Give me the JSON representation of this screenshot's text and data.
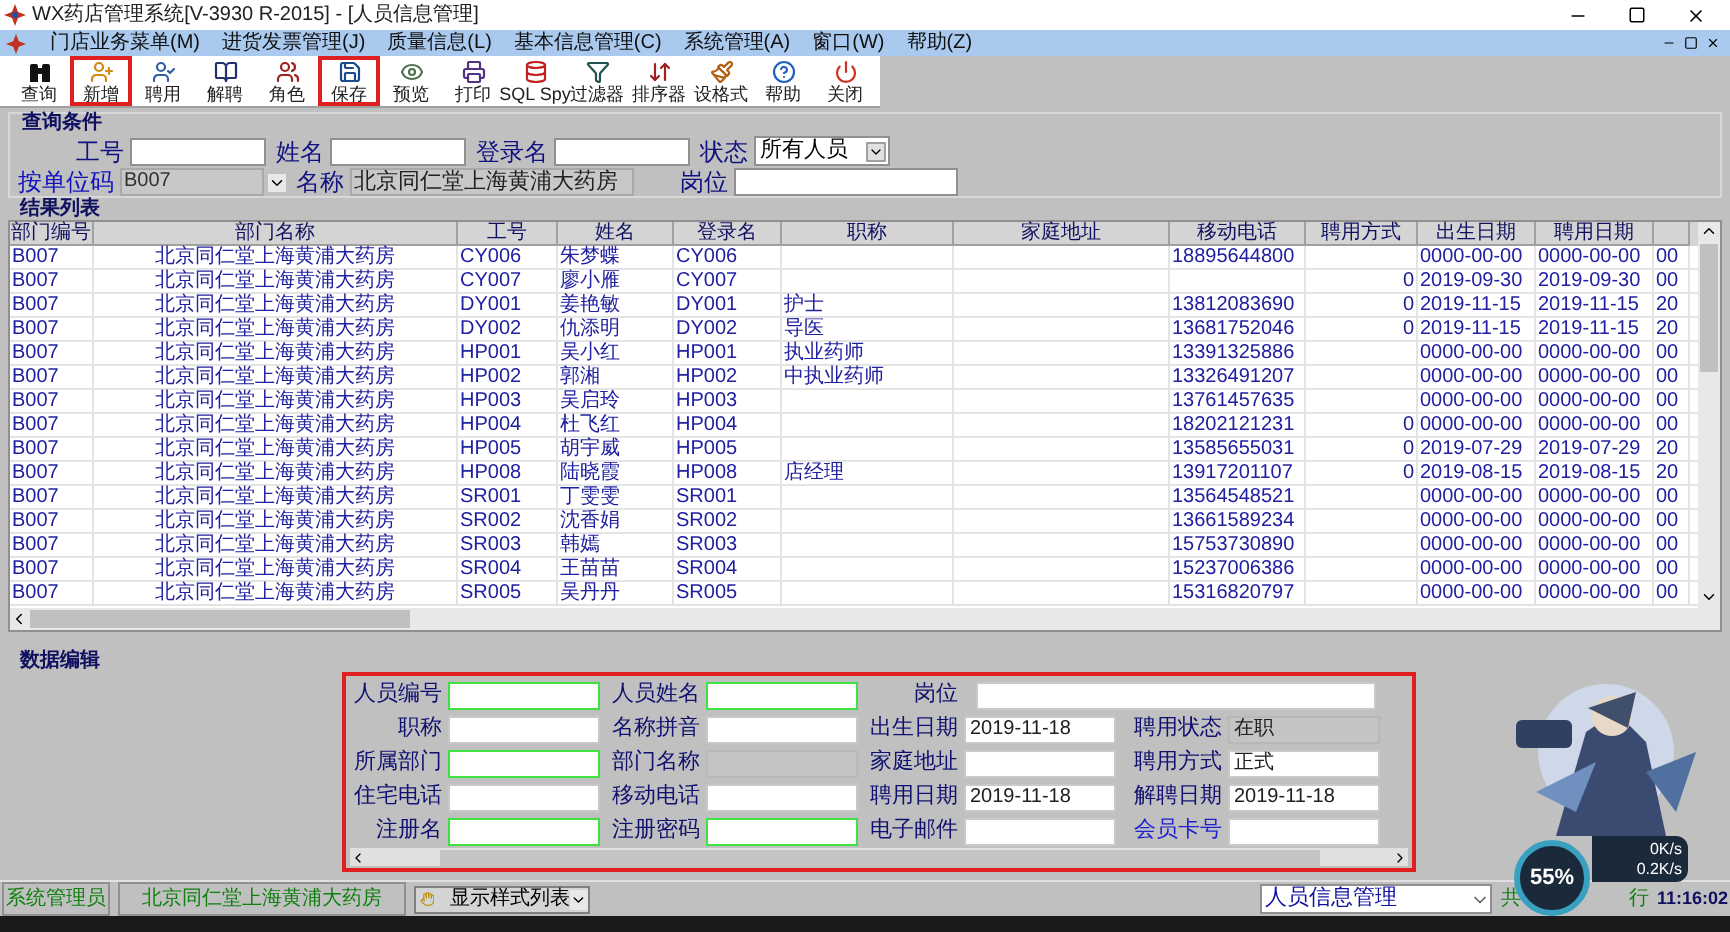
{
  "window": {
    "title": "WX药店管理系统[V-3930 R-2015] - [人员信息管理]"
  },
  "menu": [
    {
      "label": "门店业务菜单(M)"
    },
    {
      "label": "进货发票管理(J)"
    },
    {
      "label": "质量信息(L)"
    },
    {
      "label": "基本信息管理(C)"
    },
    {
      "label": "系统管理(A)"
    },
    {
      "label": "窗口(W)"
    },
    {
      "label": "帮助(Z)"
    }
  ],
  "toolbar": [
    {
      "label": "查询",
      "highlighted": false
    },
    {
      "label": "新增",
      "highlighted": true
    },
    {
      "label": "聘用",
      "highlighted": false
    },
    {
      "label": "解聘",
      "highlighted": false
    },
    {
      "label": "角色",
      "highlighted": false
    },
    {
      "label": "保存",
      "highlighted": true
    },
    {
      "label": "预览",
      "highlighted": false
    },
    {
      "label": "打印",
      "highlighted": false
    },
    {
      "label": "SQL Spy",
      "highlighted": false
    },
    {
      "label": "过滤器",
      "highlighted": false
    },
    {
      "label": "排序器",
      "highlighted": false
    },
    {
      "label": "设格式",
      "highlighted": false
    },
    {
      "label": "帮助",
      "highlighted": false
    },
    {
      "label": "关闭",
      "highlighted": false
    }
  ],
  "query": {
    "title": "查询条件",
    "fields": [
      {
        "label": "工号",
        "kind": "text",
        "link": false
      },
      {
        "label": "姓名",
        "kind": "text",
        "link": false
      },
      {
        "label": "登录名",
        "kind": "text",
        "link": false
      },
      {
        "label": "状态",
        "kind": "select",
        "value": "所有人员",
        "link": false
      },
      {
        "label": "按单位码",
        "kind": "code",
        "value": "B007",
        "link": true
      },
      {
        "label": "名称",
        "kind": "readonly",
        "value": "北京同仁堂上海黄浦大药房",
        "link": false
      },
      {
        "label": "岗位",
        "kind": "wide",
        "link": false
      }
    ]
  },
  "results": {
    "title": "结果列表",
    "columns": [
      "部门编号",
      "部门名称",
      "工号",
      "姓名",
      "登录名",
      "职称",
      "家庭地址",
      "移动电话",
      "聘用方式",
      "出生日期",
      "聘用日期",
      ""
    ],
    "rows": [
      [
        "B007",
        "北京同仁堂上海黄浦大药房",
        "CY006",
        "朱梦蝶",
        "CY006",
        "",
        "",
        "18895644800",
        "",
        "0000-00-00",
        "0000-00-00",
        "00"
      ],
      [
        "B007",
        "北京同仁堂上海黄浦大药房",
        "CY007",
        "廖小雁",
        "CY007",
        "",
        "",
        "",
        "0",
        "2019-09-30",
        "2019-09-30",
        "00"
      ],
      [
        "B007",
        "北京同仁堂上海黄浦大药房",
        "DY001",
        "姜艳敏",
        "DY001",
        "护士",
        "",
        "13812083690",
        "0",
        "2019-11-15",
        "2019-11-15",
        "20"
      ],
      [
        "B007",
        "北京同仁堂上海黄浦大药房",
        "DY002",
        "仇添明",
        "DY002",
        "导医",
        "",
        "13681752046",
        "0",
        "2019-11-15",
        "2019-11-15",
        "20"
      ],
      [
        "B007",
        "北京同仁堂上海黄浦大药房",
        "HP001",
        "吴小红",
        "HP001",
        "执业药师",
        "",
        "13391325886",
        "",
        "0000-00-00",
        "0000-00-00",
        "00"
      ],
      [
        "B007",
        "北京同仁堂上海黄浦大药房",
        "HP002",
        "郭湘",
        "HP002",
        "中执业药师",
        "",
        "13326491207",
        "",
        "0000-00-00",
        "0000-00-00",
        "00"
      ],
      [
        "B007",
        "北京同仁堂上海黄浦大药房",
        "HP003",
        "吴启玲",
        "HP003",
        "",
        "",
        "13761457635",
        "",
        "0000-00-00",
        "0000-00-00",
        "00"
      ],
      [
        "B007",
        "北京同仁堂上海黄浦大药房",
        "HP004",
        "杜飞红",
        "HP004",
        "",
        "",
        "18202121231",
        "0",
        "0000-00-00",
        "0000-00-00",
        "00"
      ],
      [
        "B007",
        "北京同仁堂上海黄浦大药房",
        "HP005",
        "胡宇威",
        "HP005",
        "",
        "",
        "13585655031",
        "0",
        "2019-07-29",
        "2019-07-29",
        "20"
      ],
      [
        "B007",
        "北京同仁堂上海黄浦大药房",
        "HP008",
        "陆晓霞",
        "HP008",
        "店经理",
        "",
        "13917201107",
        "0",
        "2019-08-15",
        "2019-08-15",
        "20"
      ],
      [
        "B007",
        "北京同仁堂上海黄浦大药房",
        "SR001",
        "丁雯雯",
        "SR001",
        "",
        "",
        "13564548521",
        "",
        "0000-00-00",
        "0000-00-00",
        "00"
      ],
      [
        "B007",
        "北京同仁堂上海黄浦大药房",
        "SR002",
        "沈香娟",
        "SR002",
        "",
        "",
        "13661589234",
        "",
        "0000-00-00",
        "0000-00-00",
        "00"
      ],
      [
        "B007",
        "北京同仁堂上海黄浦大药房",
        "SR003",
        "韩嫣",
        "SR003",
        "",
        "",
        "15753730890",
        "",
        "0000-00-00",
        "0000-00-00",
        "00"
      ],
      [
        "B007",
        "北京同仁堂上海黄浦大药房",
        "SR004",
        "王苗苗",
        "SR004",
        "",
        "",
        "15237006386",
        "",
        "0000-00-00",
        "0000-00-00",
        "00"
      ],
      [
        "B007",
        "北京同仁堂上海黄浦大药房",
        "SR005",
        "吴丹丹",
        "SR005",
        "",
        "",
        "15316820797",
        "",
        "0000-00-00",
        "0000-00-00",
        "00"
      ]
    ]
  },
  "form": {
    "title": "数据编辑",
    "highlighted": true,
    "fields": [
      {
        "label": "人员编号",
        "kind": "required",
        "link": false
      },
      {
        "label": "人员姓名",
        "kind": "required",
        "link": false
      },
      {
        "label": "岗位",
        "kind": "wide",
        "link": false
      },
      {
        "label": "职称",
        "kind": "normal",
        "link": false
      },
      {
        "label": "名称拼音",
        "kind": "normal",
        "link": false
      },
      {
        "label": "出生日期",
        "kind": "normal",
        "value": "2019-11-18",
        "link": false
      },
      {
        "label": "聘用状态",
        "kind": "readonly",
        "value": "在职",
        "link": false
      },
      {
        "label": "所属部门",
        "kind": "required",
        "link": false
      },
      {
        "label": "部门名称",
        "kind": "readonly",
        "link": false
      },
      {
        "label": "家庭地址",
        "kind": "normal",
        "link": false
      },
      {
        "label": "聘用方式",
        "kind": "normal",
        "value": "正式",
        "link": false
      },
      {
        "label": "住宅电话",
        "kind": "normal",
        "link": false
      },
      {
        "label": "移动电话",
        "kind": "normal",
        "link": false
      },
      {
        "label": "聘用日期",
        "kind": "normal",
        "value": "2019-11-18",
        "link": false
      },
      {
        "label": "解聘日期",
        "kind": "normal",
        "value": "2019-11-18",
        "link": false
      },
      {
        "label": "注册名",
        "kind": "required",
        "link": false
      },
      {
        "label": "注册密码",
        "kind": "required",
        "link": false
      },
      {
        "label": "电子邮件",
        "kind": "normal",
        "link": false
      },
      {
        "label": "会员卡号",
        "kind": "normal",
        "link": true
      }
    ]
  },
  "status_bar": {
    "user": "系统管理员",
    "store": "北京同仁堂上海黄浦大药房",
    "style_select": "显示样式列表",
    "module_select": "人员信息管理",
    "count_label": "共",
    "row_label": "行",
    "time": "11:16:02"
  },
  "speed_widget": {
    "percent": "55%",
    "upload": "0K/s",
    "download": "0.2K/s"
  }
}
